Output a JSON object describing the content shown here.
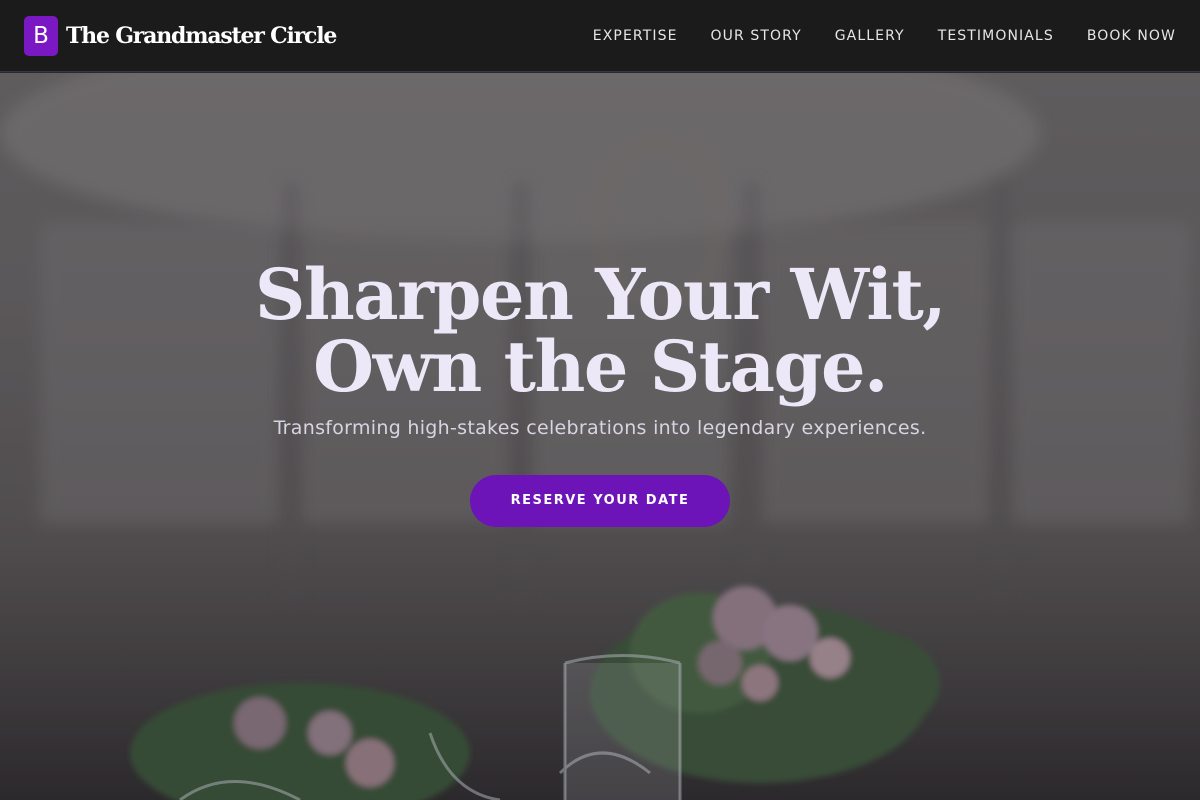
{
  "navbar": {
    "logo_letter": "B",
    "brand_name": "The Grandmaster Circle",
    "links": [
      {
        "label": "EXPERTISE"
      },
      {
        "label": "OUR STORY"
      },
      {
        "label": "GALLERY"
      },
      {
        "label": "TESTIMONIALS"
      },
      {
        "label": "BOOK NOW"
      }
    ]
  },
  "hero": {
    "title": "Sharpen Your Wit, Own the Stage.",
    "subtitle": "Transforming high-stakes celebrations into legendary experiences.",
    "cta_label": "RESERVE YOUR DATE"
  },
  "colors": {
    "navbar_bg": "#1b1b1b",
    "brand_accent": "#7a19c4",
    "cta_bg": "#6c14b8",
    "hero_text": "#ece8f7"
  }
}
